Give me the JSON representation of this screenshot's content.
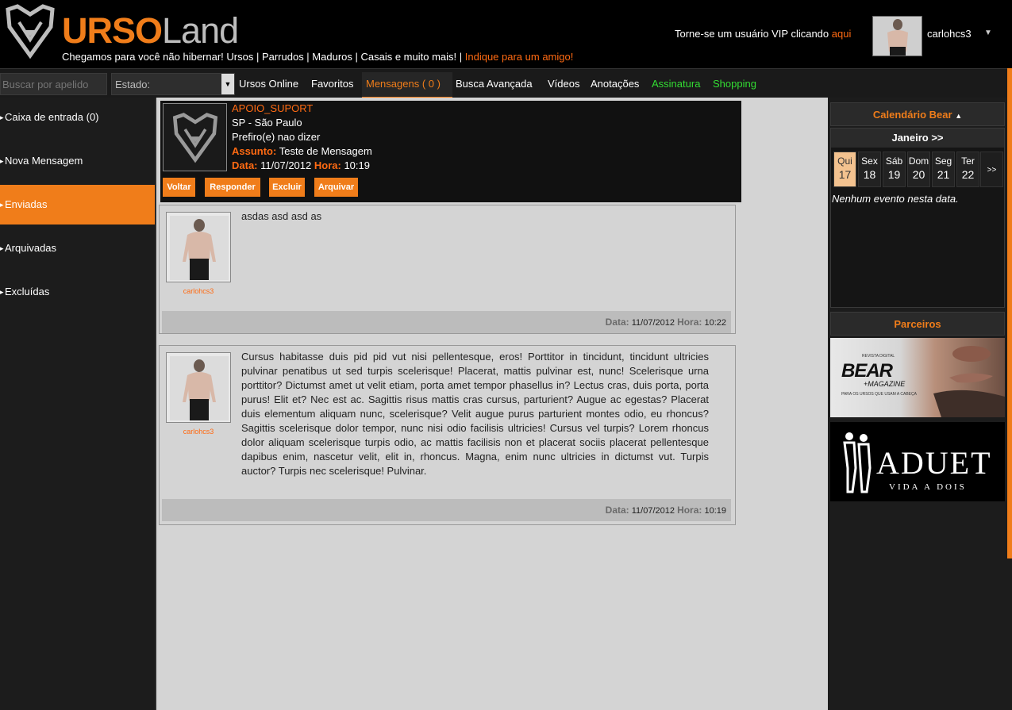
{
  "header": {
    "logo_urso": "URSO",
    "logo_land": "Land",
    "tagline_main": "Chegamos para você não hibernar! Ursos | Parrudos | Maduros | Casais e muito mais! |",
    "tagline_link": "Indique para um amigo!",
    "vip_text": "Torne-se um usuário VIP clicando",
    "vip_link": "aqui",
    "username": "carlohcs3",
    "user_caret": "▼"
  },
  "navbar": {
    "search_placeholder": "Buscar por apelido",
    "state_label": "Estado:",
    "state_caret": "▼",
    "items": [
      {
        "label": "Ursos Online"
      },
      {
        "label": "Favoritos"
      },
      {
        "label": "Mensagens ( 0 )"
      },
      {
        "label": "Busca Avançada"
      },
      {
        "label": "Vídeos"
      },
      {
        "label": "Anotações"
      },
      {
        "label": "Assinatura"
      },
      {
        "label": "Shopping"
      }
    ]
  },
  "sidebar": {
    "items": [
      {
        "label": "Caixa de entrada (0)"
      },
      {
        "label": "Nova Mensagem"
      },
      {
        "label": "Enviadas"
      },
      {
        "label": "Arquivadas"
      },
      {
        "label": "Excluídas"
      }
    ]
  },
  "message": {
    "sender": "APOIO_SUPORT",
    "location": "SP - São Paulo",
    "preference": "Prefiro(e) nao dizer",
    "subject_label": "Assunto:",
    "subject": "Teste de Mensagem",
    "date_label": "Data:",
    "date": "11/07/2012",
    "time_label": "Hora:",
    "time": "10:19",
    "actions": {
      "back": "Voltar",
      "reply": "Responder",
      "delete": "Excluir",
      "archive": "Arquivar"
    }
  },
  "thread": [
    {
      "user": "carlohcs3",
      "text": "asdas asd asd as",
      "date_label": "Data:",
      "date": "11/07/2012",
      "time_label": "Hora:",
      "time": "10:22"
    },
    {
      "user": "carlohcs3",
      "text": "Cursus habitasse duis pid pid vut nisi pellentesque, eros! Porttitor in tincidunt, tincidunt ultricies pulvinar penatibus ut sed turpis scelerisque! Placerat, mattis pulvinar est, nunc! Scelerisque urna porttitor? Dictumst amet ut velit etiam, porta amet tempor phasellus in? Lectus cras, duis porta, porta purus! Elit et? Nec est ac. Sagittis risus mattis cras cursus, parturient? Augue ac egestas? Placerat duis elementum aliquam nunc, scelerisque? Velit augue purus parturient montes odio, eu rhoncus? Sagittis scelerisque dolor tempor, nunc nisi odio facilisis ultricies! Cursus vel turpis? Lorem rhoncus dolor aliquam scelerisque turpis odio, ac mattis facilisis non et placerat sociis placerat pellentesque dapibus enim, nascetur velit, elit in, rhoncus. Magna, enim nunc ultricies in dictumst vut. Turpis auctor? Turpis nec scelerisque! Pulvinar.",
      "date_label": "Data:",
      "date": "11/07/2012",
      "time_label": "Hora:",
      "time": "10:19"
    }
  ],
  "calendar": {
    "title": "Calendário Bear",
    "title_caret": "▲",
    "month": "Janeiro >>",
    "days": [
      {
        "name": "Qui",
        "num": "17"
      },
      {
        "name": "Sex",
        "num": "18"
      },
      {
        "name": "Sáb",
        "num": "19"
      },
      {
        "name": "Dom",
        "num": "20"
      },
      {
        "name": "Seg",
        "num": "21"
      },
      {
        "name": "Ter",
        "num": "22"
      }
    ],
    "next": ">>",
    "empty": "Nenhum evento nesta data."
  },
  "partners": {
    "title": "Parceiros",
    "bear_small_top": "REVISTA DIGITAL",
    "bear_logo": "BEAR",
    "bear_sub": "+MAGAZINE",
    "bear_small_bottom": "PARA OS URSOS QUE USAM A CABEÇA",
    "aduet_logo": "ADUET",
    "aduet_sub": "VIDA A DOIS"
  },
  "colors": {
    "accent": "#f07d1a",
    "link": "#ff6a12",
    "green": "#33dd33",
    "background": "#1c1c1c"
  }
}
